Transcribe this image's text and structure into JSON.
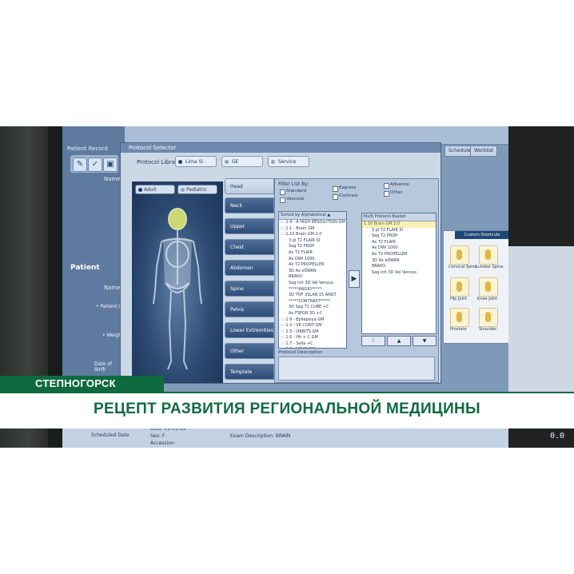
{
  "left_app": {
    "header": "Patient Record",
    "name_col": "Name",
    "patient_section": "Patient",
    "patient_name_col": "Name",
    "fields": [
      "• Patient ID",
      "• Weight",
      "Date of Birth"
    ]
  },
  "dialog": {
    "title": "Protocol Selector",
    "library_label": "Protocol Library:",
    "library_tabs": [
      "Lima SI",
      "GE",
      "Service"
    ],
    "age_tabs": [
      "Adult",
      "Pediatric"
    ],
    "regions": [
      "Head",
      "Neck",
      "Upper Extremities",
      "Chest",
      "Abdomen",
      "Spine",
      "Pelvis",
      "Lower Extremities",
      "Other",
      "Template"
    ],
    "filter_label": "Filter List By:",
    "filters": [
      "Standard",
      "Vascular",
      "Express",
      "Contrast",
      "Advance",
      "Other"
    ],
    "sorted_header": "Sorted by Alphabetical ▲",
    "protocols": [
      {
        "text": "1.4 - A HIGH RESOLUTION GM",
        "type": "folder"
      },
      {
        "text": "1.1 - Brain GM",
        "type": "folder"
      },
      {
        "text": "1.10 Brain GM 2.0",
        "type": "folder"
      },
      {
        "text": "3 pl T2 FLAIR SI",
        "type": "sub"
      },
      {
        "text": "Sag T2 PROP",
        "type": "sub"
      },
      {
        "text": "Ax T2 FLAIR",
        "type": "sub"
      },
      {
        "text": "Ax DWI 1000",
        "type": "sub"
      },
      {
        "text": "Ax T2 PROPELLER",
        "type": "sub"
      },
      {
        "text": "3D Ax eSWAN",
        "type": "sub"
      },
      {
        "text": "BRAVO",
        "type": "sub"
      },
      {
        "text": "Sag inh 3D Vel Venous",
        "type": "sub"
      },
      {
        "text": "*****ANGIO*****",
        "type": "sub"
      },
      {
        "text": "3D TOF 3SLAB 15 ANGT",
        "type": "sub"
      },
      {
        "text": "*****CONTRAST*****",
        "type": "sub"
      },
      {
        "text": "3D Sag T1 CUBE +C",
        "type": "sub"
      },
      {
        "text": "Ax FSPGR 3D +C",
        "type": "sub"
      },
      {
        "text": "1.9 - Epilepsiya GM",
        "type": "folder"
      },
      {
        "text": "1.2 - VK CONT GM",
        "type": "folder"
      },
      {
        "text": "1.5 - ORBITS GM",
        "type": "folder"
      },
      {
        "text": "1.6 - Hh + C GM",
        "type": "folder"
      },
      {
        "text": "1.7 - Sella +C",
        "type": "folder"
      },
      {
        "text": "1.3 - VOUS GM",
        "type": "folder"
      }
    ],
    "basket_header": "Multi Protocol Basket",
    "basket": [
      {
        "text": "1.10 Brain GM 2.0",
        "sel": true
      },
      {
        "text": "3 pl T2 FLAIR SI",
        "sel": false
      },
      {
        "text": "Sag T2 PROP",
        "sel": false
      },
      {
        "text": "Ax T2 FLAIR",
        "sel": false
      },
      {
        "text": "Ax DWI 1000",
        "sel": false
      },
      {
        "text": "Ax T2 PROPELLER",
        "sel": false
      },
      {
        "text": "3D Ax eSWAN",
        "sel": false
      },
      {
        "text": "BRAVO",
        "sel": false
      },
      {
        "text": "Sag inh 3D Vel Venous",
        "sel": false
      }
    ],
    "move_button": "▶",
    "basket_buttons": [
      "i",
      "▲",
      "▼"
    ],
    "description_label": "Protocol Description"
  },
  "right_app": {
    "tabs": [
      "Scheduled",
      "Worklist"
    ],
    "shortcut_tab": "Custom Shortcuts",
    "shortcuts": [
      "Cervical Spine",
      "Lumbar Spine",
      "Hip Joint",
      "Knee Joint",
      "Prostate",
      "Shoulder"
    ],
    "lower": [
      "DOB: 01-01-19",
      "Sex: F",
      "Accession:",
      "Exam Description: BRAIN",
      "Scheduled Date"
    ],
    "value": "0.0"
  },
  "overlay": {
    "location": "СТЕПНОГОРСК",
    "headline": "РЕЦЕПТ РАЗВИТИЯ РЕГИОНАЛЬНОЙ МЕДИЦИНЫ"
  },
  "colors": {
    "brand_green": "#0f6b3f",
    "screen_blue": "#7f99b9",
    "basket_selected": "#f7f1b5"
  }
}
